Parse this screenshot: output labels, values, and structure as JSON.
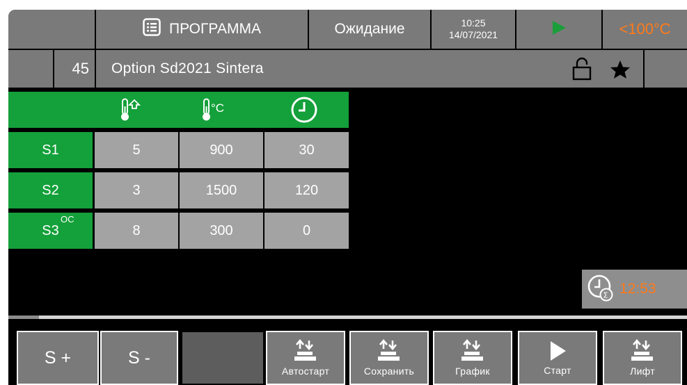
{
  "header": {
    "program_label": "ПРОГРАММА",
    "program_icon": "list-icon",
    "status": "Ожидание",
    "time": "10:25",
    "date": "14/07/2021",
    "play_icon": "play-icon",
    "play_color": "#1a9e3a",
    "temperature": "<100°C",
    "temperature_color": "#ff7a1a"
  },
  "program": {
    "number": "45",
    "name": "Option Sd2021 Sintera",
    "lock_icon": "unlocked-icon",
    "favorite_icon": "star-icon"
  },
  "table": {
    "headers": [
      {
        "icon": "thermometer-rise-icon"
      },
      {
        "icon": "thermometer-celsius-icon"
      },
      {
        "icon": "clock-icon"
      }
    ],
    "rows": [
      {
        "label": "S1",
        "tag": "",
        "values": [
          "5",
          "900",
          "30"
        ]
      },
      {
        "label": "S2",
        "tag": "",
        "values": [
          "3",
          "1500",
          "120"
        ]
      },
      {
        "label": "S3",
        "tag": "OC",
        "values": [
          "8",
          "300",
          "0"
        ]
      }
    ]
  },
  "timer": {
    "icon": "clock-sum-icon",
    "value": "12:53",
    "color": "#ff7a1a"
  },
  "progress": {
    "fraction": 0.045
  },
  "buttons": {
    "s_plus": "S +",
    "s_minus": "S -",
    "autostart": "Автостарт",
    "save": "Сохранить",
    "graph": "График",
    "start": "Старт",
    "lift": "Лифт"
  }
}
